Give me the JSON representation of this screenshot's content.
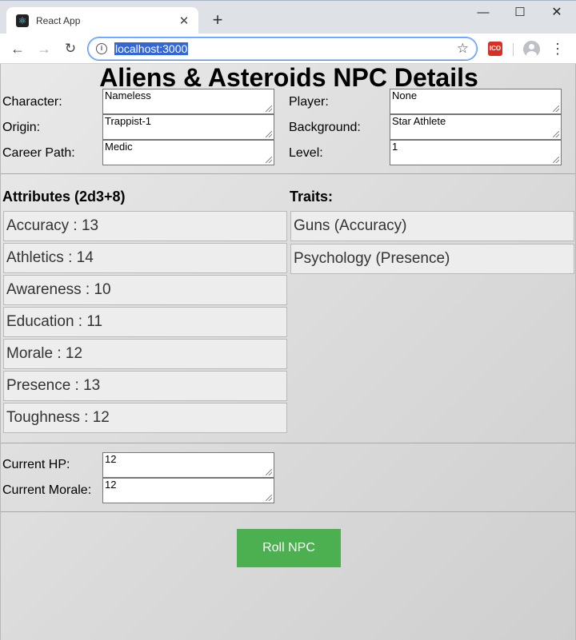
{
  "browser": {
    "tab_title": "React App",
    "tab_close": "✕",
    "new_tab": "+",
    "window_controls": {
      "minimize": "—",
      "maximize": "☐",
      "close": "✕"
    },
    "nav": {
      "back": "←",
      "forward": "→",
      "reload": "↻"
    },
    "url": "localhost:3000",
    "icons": [
      "react-favicon-icon",
      "info-icon",
      "star-icon",
      "extension-icon",
      "avatar-icon",
      "menu-icon"
    ]
  },
  "page": {
    "title": "Aliens & Asteroids NPC Details",
    "fields": {
      "character": {
        "label": "Character:",
        "value": "Nameless"
      },
      "player": {
        "label": "Player:",
        "value": "None"
      },
      "origin": {
        "label": "Origin:",
        "value": "Trappist-1"
      },
      "background": {
        "label": "Background:",
        "value": "Star Athlete"
      },
      "career_path": {
        "label": "Career Path:",
        "value": "Medic"
      },
      "level": {
        "label": "Level:",
        "value": "1"
      }
    },
    "attributes": {
      "heading": "Attributes (2d3+8)",
      "items": [
        "Accuracy : 13",
        "Athletics : 14",
        "Awareness : 10",
        "Education : 11",
        "Morale : 12",
        "Presence : 13",
        "Toughness : 12"
      ]
    },
    "traits": {
      "heading": "Traits:",
      "items": [
        "Guns (Accuracy)",
        "Psychology (Presence)"
      ]
    },
    "status": {
      "current_hp": {
        "label": "Current HP:",
        "value": "12"
      },
      "current_morale": {
        "label": "Current Morale:",
        "value": "12"
      }
    },
    "roll_button": "Roll NPC"
  },
  "colors": {
    "button_green": "#4caf50",
    "url_highlight": "#3367d6",
    "page_background": "#e0e0e0"
  }
}
